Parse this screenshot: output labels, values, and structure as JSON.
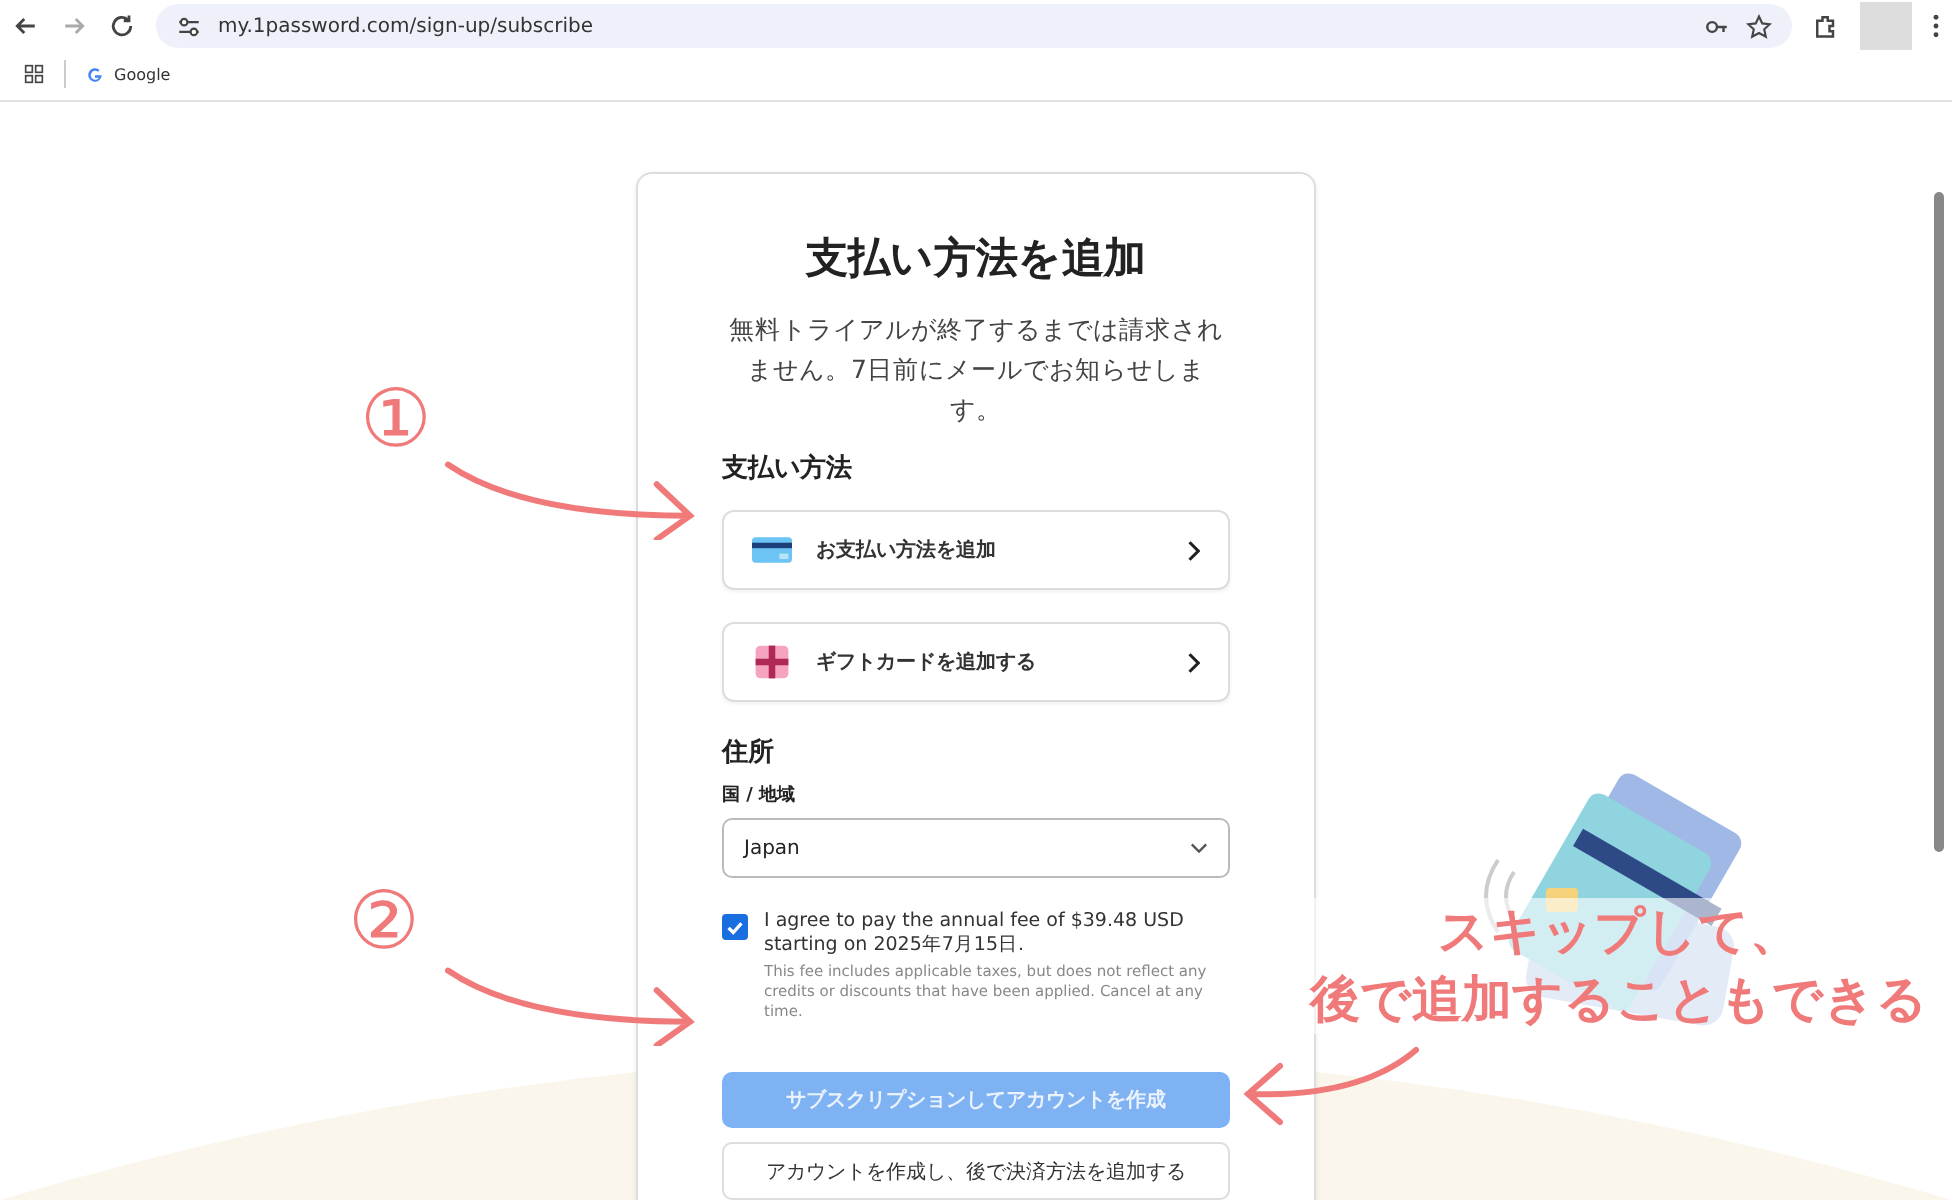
{
  "browser": {
    "url": "my.1password.com/sign-up/subscribe",
    "bookmarks": [
      {
        "label": "Google"
      }
    ]
  },
  "card": {
    "title": "支払い方法を追加",
    "subtitle": "無料トライアルが終了するまでは請求されません。7日前にメールでお知らせします。",
    "payment_section": "支払い方法",
    "payment_options": [
      {
        "kind": "card",
        "label": "お支払い方法を追加"
      },
      {
        "kind": "gift",
        "label": "ギフトカードを追加する"
      }
    ],
    "address_section": "住所",
    "country_label": "国 / 地域",
    "country_value": "Japan",
    "agreement": {
      "checked": true,
      "text": "I agree to pay the annual fee of $39.48 USD starting on 2025年7月15日.",
      "note": "This fee includes applicable taxes, but does not reflect any credits or discounts that have been applied. Cancel at any time."
    },
    "subscribe_button": {
      "label": "サブスクリプションしてアカウントを作成",
      "disabled": true
    },
    "later_button": {
      "label": "アカウントを作成し、後で決済方法を追加する"
    }
  },
  "annotations": {
    "markers": [
      "①",
      "②"
    ],
    "caption": [
      "スキップして、",
      "後で追加することもできる"
    ]
  }
}
